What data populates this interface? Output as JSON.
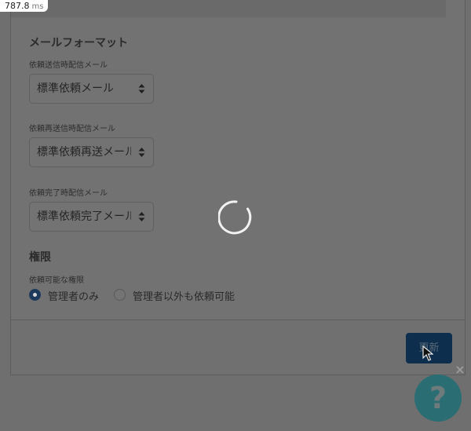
{
  "timer": {
    "value": "787.8",
    "unit": "ms"
  },
  "mail_format": {
    "title": "メールフォーマット",
    "fields": [
      {
        "label": "依頼送信時配信メール",
        "value": "標準依頼メール"
      },
      {
        "label": "依頼再送信時配信メール",
        "value": "標準依頼再送メール"
      },
      {
        "label": "依頼完了時配信メール",
        "value": "標準依頼完了メール"
      }
    ]
  },
  "permission": {
    "title": "権限",
    "label": "依頼可能な権限",
    "options": [
      {
        "label": "管理者のみ",
        "selected": true
      },
      {
        "label": "管理者以外も依頼可能",
        "selected": false
      }
    ]
  },
  "footer": {
    "update_label": "更新"
  },
  "help": {
    "label": "?",
    "close": "×"
  },
  "colors": {
    "primary": "#0d2f4d",
    "help": "#2a6e73"
  }
}
